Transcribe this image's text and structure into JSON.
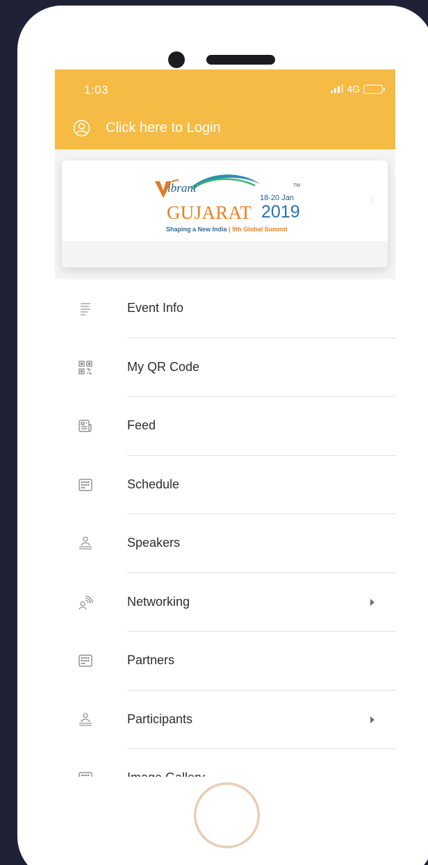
{
  "status_bar": {
    "time": "1:03",
    "network": "4G"
  },
  "header": {
    "login_text": "Click here to Login",
    "background_color": "#f5bb44"
  },
  "banner": {
    "logo_brand": "ibrant",
    "logo_main": "GUJARAT",
    "logo_year": "2019",
    "logo_dates": "18-20 Jan",
    "logo_tm": "TM",
    "logo_tag_left": "Shaping a New India",
    "logo_tag_right": "9th Global Summit"
  },
  "menu": {
    "items": [
      {
        "label": "Event Info",
        "icon": "list-icon",
        "has_arrow": false
      },
      {
        "label": "My QR Code",
        "icon": "qr-code-icon",
        "has_arrow": false
      },
      {
        "label": "Feed",
        "icon": "newspaper-icon",
        "has_arrow": false
      },
      {
        "label": "Schedule",
        "icon": "calendar-icon",
        "has_arrow": false
      },
      {
        "label": "Speakers",
        "icon": "speaker-person-icon",
        "has_arrow": false
      },
      {
        "label": "Networking",
        "icon": "networking-icon",
        "has_arrow": true
      },
      {
        "label": "Partners",
        "icon": "calendar-icon",
        "has_arrow": false
      },
      {
        "label": "Participants",
        "icon": "speaker-person-icon",
        "has_arrow": true
      },
      {
        "label": "Image Gallery",
        "icon": "gallery-icon",
        "has_arrow": false
      }
    ]
  }
}
